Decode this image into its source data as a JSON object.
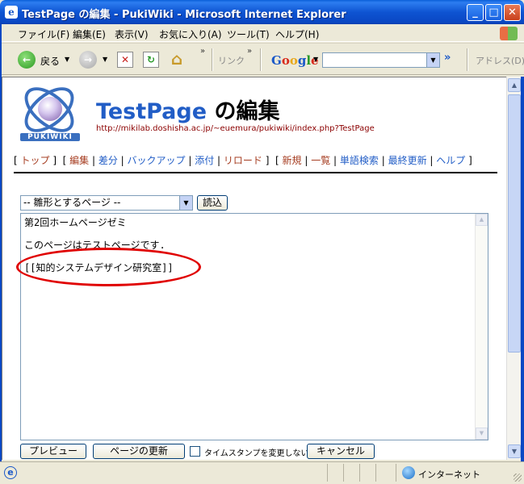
{
  "window": {
    "title": "TestPage の編集 - PukiWiki - Microsoft Internet Explorer",
    "app_icon": "e",
    "controls": {
      "minimize": "_",
      "maximize": "□",
      "close": "✕"
    }
  },
  "menu": {
    "items": [
      "ファイル(F)",
      "編集(E)",
      "表示(V)",
      "お気に入り(A)",
      "ツール(T)",
      "ヘルプ(H)"
    ]
  },
  "toolbar": {
    "back_label": "戻る",
    "links_label": "リンク",
    "google_logo": [
      "G",
      "o",
      "o",
      "g",
      "l",
      "e"
    ],
    "google_colors": [
      "#1a58c8",
      "#d82a1c",
      "#e8a81c",
      "#1a58c8",
      "#2a9a2a",
      "#d82a1c"
    ],
    "address_label": "アドレス(D)"
  },
  "page": {
    "logo_text": "PUKIWIKI",
    "title_main": "TestPage",
    "title_suffix": " の編集",
    "url": "http://mikilab.doshisha.ac.jp/~euemura/pukiwiki/index.php?TestPage",
    "nav": {
      "top": "トップ",
      "edit": "編集",
      "diff": "差分",
      "backup": "バックアップ",
      "attach": "添付",
      "reload": "リロード",
      "new": "新規",
      "list": "一覧",
      "search": "単語検索",
      "recent": "最終更新",
      "help": "ヘルプ"
    },
    "template_select": "-- 雛形とするページ --",
    "load_button": "読込",
    "editor_lines": [
      "第2回ホームページゼミ",
      "",
      "このページはテストページです.",
      "",
      "[[知的システムデザイン研究室]]"
    ],
    "buttons": {
      "preview": "プレビュー",
      "update": "ページの更新",
      "timestamp_label": "タイムスタンプを変更しない",
      "cancel": "キャンセル"
    },
    "accent_colors": {
      "title_blue": "#215dc6",
      "url_red": "#8b0000",
      "annotation": "#e00000"
    }
  },
  "status": {
    "zone": "インターネット"
  }
}
